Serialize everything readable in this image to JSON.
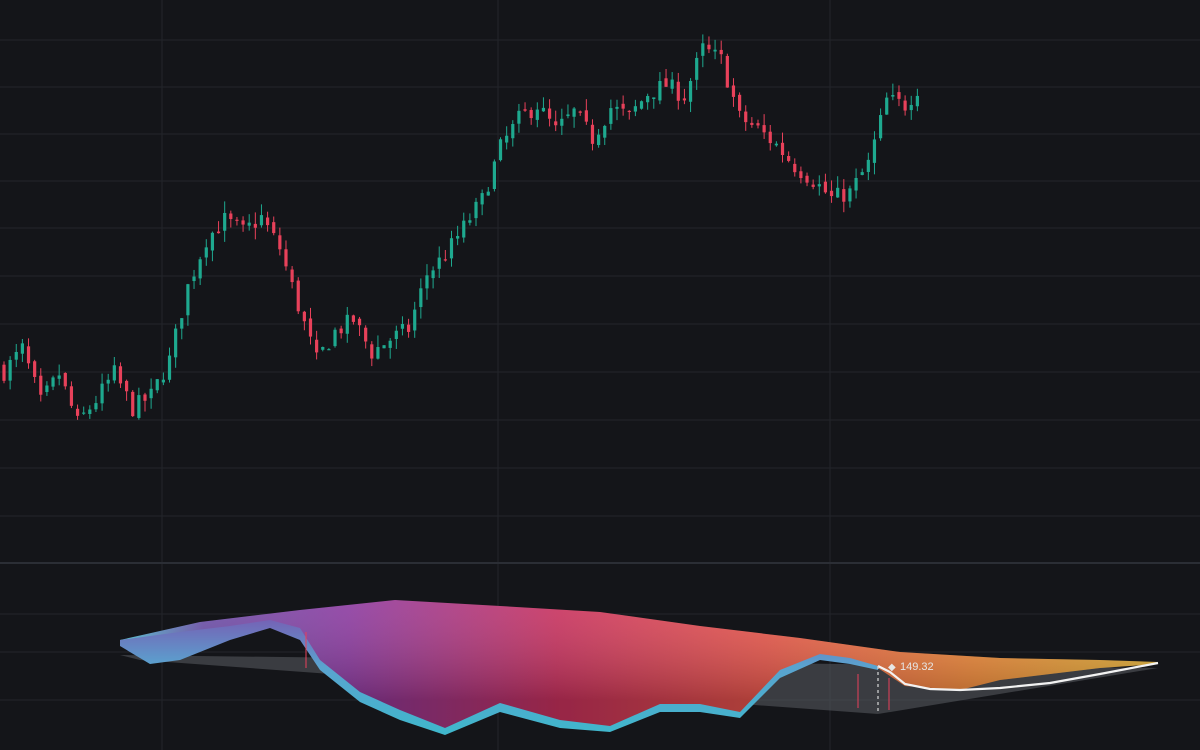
{
  "colors": {
    "background": "#141519",
    "grid": "#23252b",
    "separator": "#2b2e35",
    "up": "#1ea98f",
    "down": "#e8415a",
    "surface_stops": [
      "#50c4d8",
      "#6a4ea8",
      "#8c3aa0",
      "#c9315e",
      "#e8564a",
      "#f08a3a",
      "#e3b338"
    ],
    "ridge_line": "#f2f2f2",
    "floor": "#5a5c63"
  },
  "chart_data": [
    {
      "type": "candlestick",
      "title": "",
      "xlabel": "",
      "ylabel": "",
      "ylim": [
        140,
        200
      ],
      "grid": true,
      "candle_count": 150,
      "close_path_anchors": [
        [
          0,
          160.2
        ],
        [
          3,
          162.9
        ],
        [
          6,
          156.5
        ],
        [
          9,
          159.9
        ],
        [
          12,
          154.0
        ],
        [
          15,
          156.8
        ],
        [
          18,
          160.0
        ],
        [
          21,
          155.8
        ],
        [
          24,
          157.3
        ],
        [
          27,
          161.6
        ],
        [
          30,
          170.4
        ],
        [
          33,
          176.1
        ],
        [
          36,
          178.4
        ],
        [
          39,
          177.0
        ],
        [
          42,
          178.7
        ],
        [
          45,
          175.0
        ],
        [
          48,
          168.1
        ],
        [
          51,
          161.5
        ],
        [
          54,
          165.0
        ],
        [
          57,
          166.4
        ],
        [
          60,
          162.5
        ],
        [
          63,
          164.1
        ],
        [
          66,
          165.3
        ],
        [
          69,
          171.9
        ],
        [
          72,
          174.2
        ],
        [
          75,
          177.5
        ],
        [
          78,
          180.8
        ],
        [
          81,
          187.1
        ],
        [
          84,
          190.5
        ],
        [
          87,
          192.2
        ],
        [
          90,
          189.1
        ],
        [
          93,
          191.3
        ],
        [
          96,
          188.2
        ],
        [
          99,
          191.9
        ],
        [
          102,
          190.8
        ],
        [
          105,
          193.6
        ],
        [
          108,
          194.6
        ],
        [
          111,
          193.3
        ],
        [
          114,
          198.9
        ],
        [
          117,
          197.6
        ],
        [
          120,
          190.7
        ],
        [
          123,
          189.3
        ],
        [
          126,
          187.4
        ],
        [
          129,
          184.9
        ],
        [
          132,
          183.2
        ],
        [
          135,
          181.0
        ],
        [
          138,
          181.7
        ],
        [
          141,
          185.1
        ],
        [
          144,
          192.8
        ],
        [
          147,
          192.2
        ],
        [
          149,
          194.2
        ]
      ]
    },
    {
      "type": "area",
      "title": "",
      "xlabel": "",
      "ylabel": "",
      "annotations": [
        {
          "label": "149.32",
          "symbol": "◆"
        }
      ]
    }
  ]
}
